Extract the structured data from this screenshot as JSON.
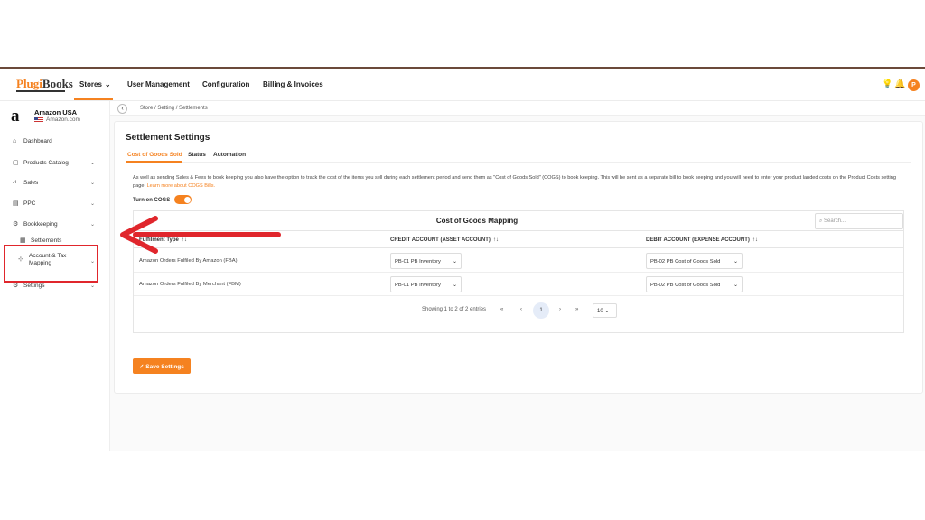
{
  "brand": {
    "logo_prefix": "Plugi",
    "logo_suffix": "Books"
  },
  "topnav": {
    "stores": "Stores",
    "user_management": "User Management",
    "configuration": "Configuration",
    "billing": "Billing & Invoices",
    "avatar_letter": "P"
  },
  "store": {
    "name": "Amazon USA",
    "domain": "Amazon.com",
    "logo": "a"
  },
  "sidebar": {
    "items": [
      {
        "label": "Dashboard",
        "icon": "home-icon"
      },
      {
        "label": "Products Catalog",
        "icon": "catalog-icon"
      },
      {
        "label": "Sales",
        "icon": "chart-icon"
      },
      {
        "label": "PPC",
        "icon": "ppc-icon"
      },
      {
        "label": "Bookkeeping",
        "icon": "gear-icon"
      },
      {
        "label": "Settlements",
        "icon": "table-icon"
      },
      {
        "label": "Account & Tax",
        "label2": "Mapping",
        "icon": "tree-icon"
      },
      {
        "label": "Settings",
        "icon": "settings-icon"
      }
    ]
  },
  "breadcrumb": "Store  /  Setting  /  Settlements",
  "page": {
    "title": "Settlement Settings",
    "tabs": [
      "Cost of Goods Sold",
      "Status",
      "Automation"
    ],
    "description": "As well as sending Sales & Fees to book keeping you also have the option to track the cost of the items you sell during each settlement period and send them as \"Cost of Goods Sold\" (COGS) to book keeping. This will be sent as a separate bill to book keeping and you will need to enter your product landed costs on the Product Costs setting page.",
    "learn_more": "Learn more about COGS Bills.",
    "toggle_label": "Turn on COGS",
    "toggle_on": true
  },
  "mapping": {
    "title": "Cost of Goods Mapping",
    "search_placeholder": "Search...",
    "columns": [
      "Fulfilment Type",
      "CREDIT ACCOUNT (ASSET ACCOUNT)",
      "DEBIT ACCOUNT (EXPENSE ACCOUNT)"
    ],
    "rows": [
      {
        "type": "Amazon Orders Fulfiled By Amazon (FBA)",
        "credit": "PB-01 PB Inventory",
        "debit": "PB-02 PB Cost of Goods Sold"
      },
      {
        "type": "Amazon Orders Fulfiled By Merchant (FBM)",
        "credit": "PB-01 PB Inventory",
        "debit": "PB-02 PB Cost of Goods Sold"
      }
    ],
    "showing": "Showing 1 to 2 of 2 entries",
    "current_page": "1",
    "page_size": "10"
  },
  "save_label": "Save Settings",
  "colors": {
    "accent": "#f58220",
    "annotation": "#e0262c"
  }
}
